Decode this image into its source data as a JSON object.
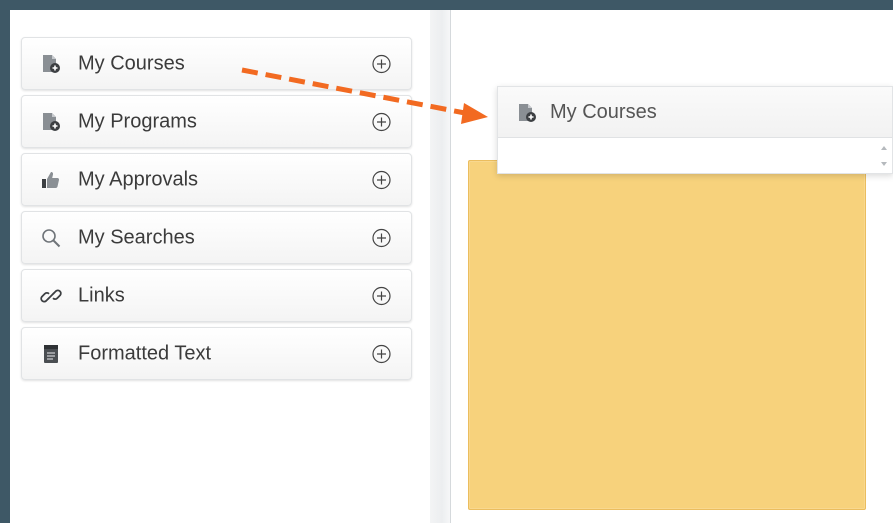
{
  "widgets": [
    {
      "label": "My Courses",
      "icon": "course-document-icon"
    },
    {
      "label": "My Programs",
      "icon": "program-document-icon"
    },
    {
      "label": "My Approvals",
      "icon": "thumbs-up-icon"
    },
    {
      "label": "My Searches",
      "icon": "search-icon"
    },
    {
      "label": "Links",
      "icon": "link-icon"
    },
    {
      "label": "Formatted Text",
      "icon": "formatted-text-icon"
    }
  ],
  "dragged_widget": {
    "title": "My Courses",
    "icon": "course-document-icon"
  },
  "colors": {
    "frame_border": "#3e5866",
    "drop_zone": "#f7d27c",
    "arrow": "#f26a21",
    "icon_gray": "#8a8f94"
  }
}
